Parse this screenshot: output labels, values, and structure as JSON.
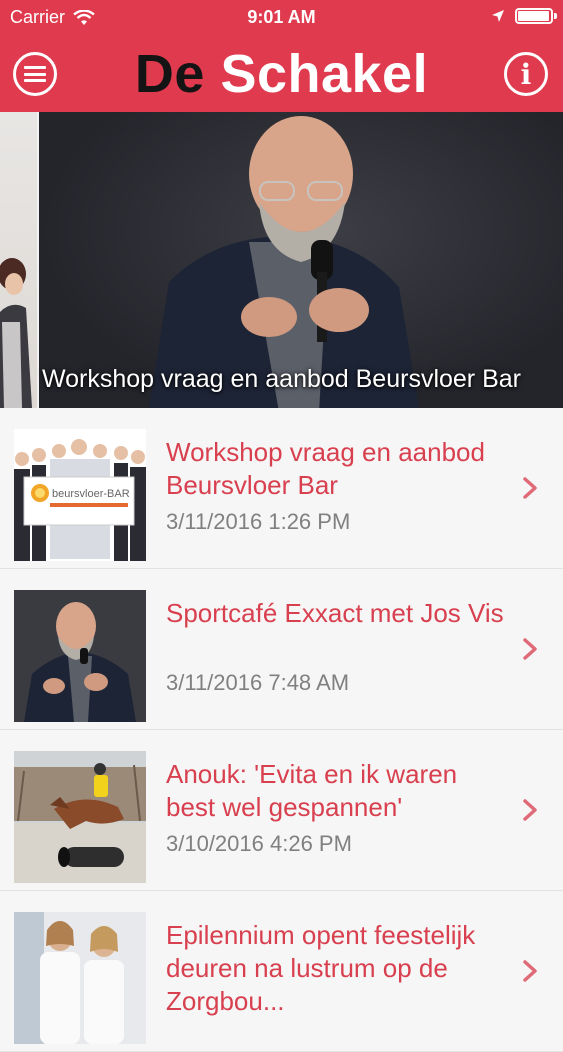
{
  "status_bar": {
    "carrier": "Carrier",
    "time": "9:01 AM"
  },
  "header": {
    "brand_part1": "De",
    "brand_part2": "Schakel",
    "menu_icon": "menu-icon",
    "info_icon": "info-icon"
  },
  "hero": {
    "caption": "Workshop vraag en aanbod Beursvloer Bar"
  },
  "articles": [
    {
      "title": "Workshop vraag en aanbod Beursvloer Bar",
      "date": "3/11/2016 1:26 PM",
      "thumb_logo_text": "beursvloer-BAR"
    },
    {
      "title": "Sportcafé Exxact met Jos Vis",
      "date": "3/11/2016 7:48 AM"
    },
    {
      "title": "Anouk: 'Evita en ik waren best wel gespannen'",
      "date": "3/10/2016 4:26 PM"
    },
    {
      "title": "Epilennium opent feestelijk deuren na lustrum op de Zorgbou..."
    }
  ],
  "colors": {
    "brand_red": "#e03a4e",
    "title_red": "#d8404f",
    "date_gray": "#808080"
  }
}
